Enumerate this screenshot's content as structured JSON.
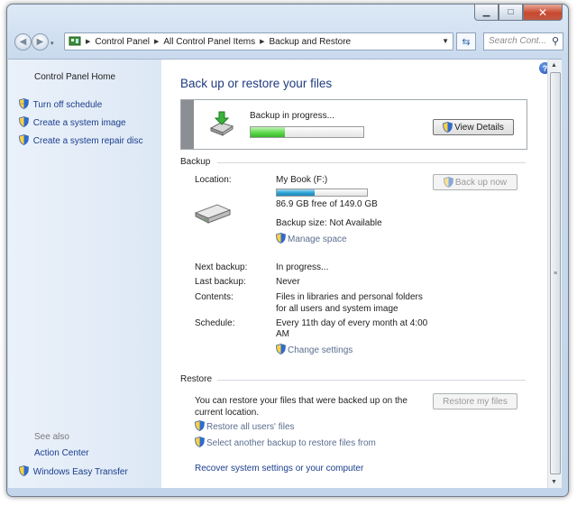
{
  "window": {
    "minimize_glyph": "▁",
    "maximize_glyph": "□",
    "close_glyph": "✕"
  },
  "nav": {
    "back_glyph": "◀",
    "forward_glyph": "▶",
    "breadcrumb": [
      "Control Panel",
      "All Control Panel Items",
      "Backup and Restore"
    ],
    "search_placeholder": "Search Cont..."
  },
  "left_pane": {
    "home_label": "Control Panel Home",
    "tasks": [
      {
        "label": "Turn off schedule",
        "icon": "shield-icon"
      },
      {
        "label": "Create a system image",
        "icon": "shield-icon"
      },
      {
        "label": "Create a system repair disc",
        "icon": "shield-icon"
      }
    ],
    "see_also_label": "See also",
    "see_also": [
      {
        "label": "Action Center"
      },
      {
        "label": "Windows Easy Transfer",
        "icon": "shield-icon"
      }
    ]
  },
  "main": {
    "title": "Back up or restore your files",
    "status": {
      "text": "Backup in progress...",
      "progress": 0.3,
      "view_details_label": "View Details"
    },
    "backup": {
      "header": "Backup",
      "location_label": "Location:",
      "location_value": "My Book (F:)",
      "drive_used_fraction": 0.42,
      "free_text": "86.9 GB free of 149.0 GB",
      "size_text": "Backup size: Not Available",
      "manage_space": "Manage space",
      "back_up_now": "Back up now",
      "next_label": "Next backup:",
      "next_value": "In progress...",
      "last_label": "Last backup:",
      "last_value": "Never",
      "contents_label": "Contents:",
      "contents_line1": "Files in libraries and personal folders",
      "contents_line2": "for all users and system image",
      "schedule_label": "Schedule:",
      "schedule_line1": "Every 11th day of every month at 4:00",
      "schedule_line2": "AM",
      "change_settings": "Change settings"
    },
    "restore": {
      "header": "Restore",
      "desc_line1": "You can restore your files that were backed up on the",
      "desc_line2": "current location.",
      "restore_my_files": "Restore my files",
      "restore_all_users": "Restore all users' files",
      "select_another": "Select another backup to restore files from",
      "recover": "Recover system settings or your computer"
    }
  },
  "colors": {
    "link": "#1a3e8c",
    "title": "#1f3a7e",
    "progress_green": "#38b62a",
    "drive_blue": "#1f86b6"
  }
}
